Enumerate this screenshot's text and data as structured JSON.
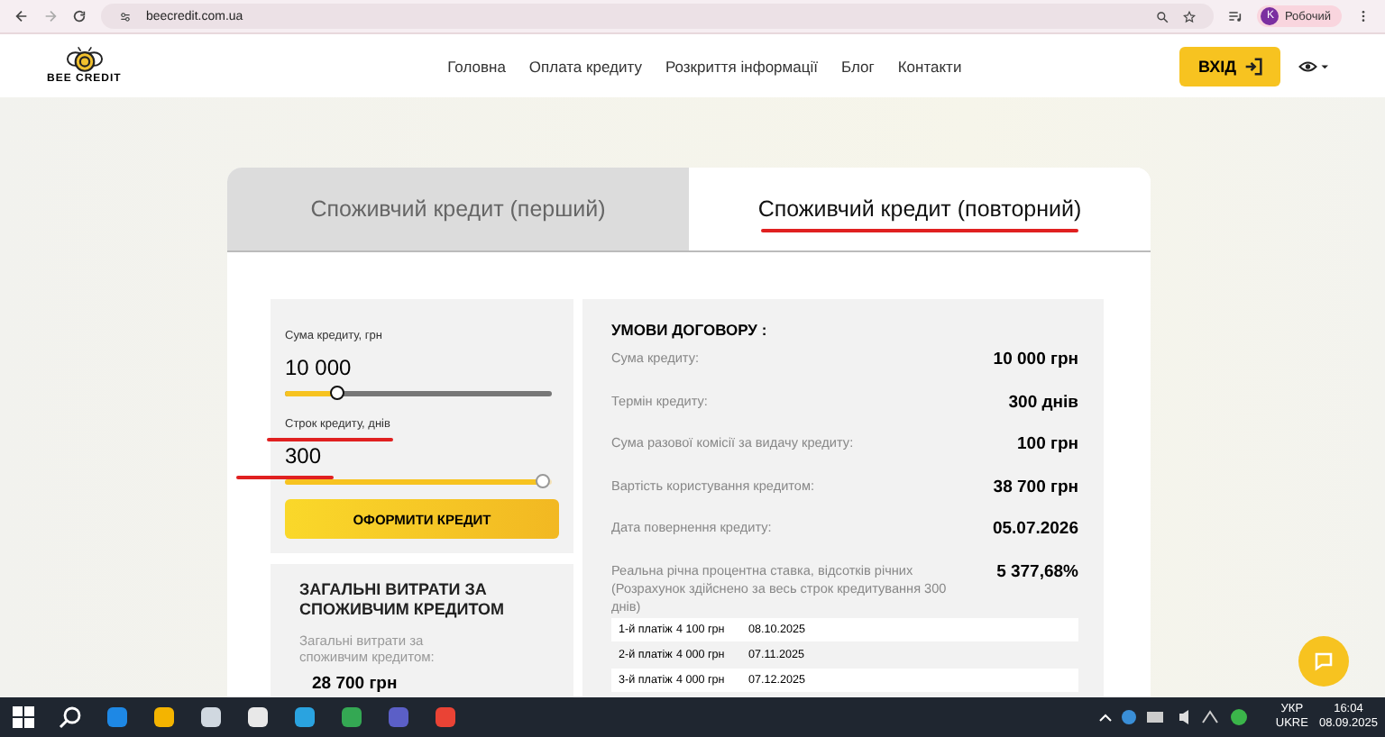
{
  "browser": {
    "url": "beecredit.com.ua",
    "profile_initial": "K",
    "profile_name": "Робочий"
  },
  "header": {
    "logo_text": "BEE CREDIT",
    "nav": [
      {
        "label": "Головна"
      },
      {
        "label": "Оплата кредиту"
      },
      {
        "label": "Розкриття інформації"
      },
      {
        "label": "Блог"
      },
      {
        "label": "Контакти"
      }
    ],
    "login": "ВХІД"
  },
  "tabs": [
    {
      "label": "Споживчий кредит (перший)",
      "selected": false
    },
    {
      "label": "Споживчий кредит (повторний)",
      "selected": true,
      "underlined": true
    }
  ],
  "calculator": {
    "sliders": [
      {
        "label": "Сума кредиту, грн",
        "value": "10 000",
        "level": 0.18
      },
      {
        "label": "Строк кредиту, днів",
        "value": "300",
        "level": 1,
        "underlined": true
      }
    ],
    "submit": "ОФОРМИТИ КРЕДИТ"
  },
  "costs": {
    "title": "ЗАГАЛЬНІ ВИТРАТИ ЗА СПОЖИВЧИМ КРЕДИТОМ",
    "label": "Загальні витрати за споживчим кредитом:",
    "value": "28 700 грн"
  },
  "terms": {
    "title": "УМОВИ ДОГОВОРУ :",
    "rows": [
      {
        "label": "Сума кредиту:",
        "value": "10 000 грн"
      },
      {
        "label": "Термін кредиту:",
        "value": "300 днів"
      },
      {
        "label": "Сума разової комісії за видачу кредиту:",
        "value": "100 грн"
      },
      {
        "label": "Вартість користування кредитом:",
        "value": "38 700 грн"
      },
      {
        "label": "Дата повернення кредиту:",
        "value": "05.07.2026"
      },
      {
        "label": "Реальна річна процентна ставка, відсотків річних (Розрахунок здійснено за весь строк кредитування 300 днів)",
        "value": "5 377,68%"
      }
    ],
    "payments": [
      {
        "name": "1-й платіж",
        "amount": "4 100 грн",
        "date": "08.10.2025"
      },
      {
        "name": "2-й платіж",
        "amount": "4 000 грн",
        "date": "07.11.2025"
      },
      {
        "name": "3-й платіж",
        "amount": "4 000 грн",
        "date": "07.12.2025"
      }
    ]
  },
  "taskbar": {
    "lang": "УКР",
    "layout": "UKRE",
    "time": "16:04",
    "date": "08.09.2025"
  }
}
